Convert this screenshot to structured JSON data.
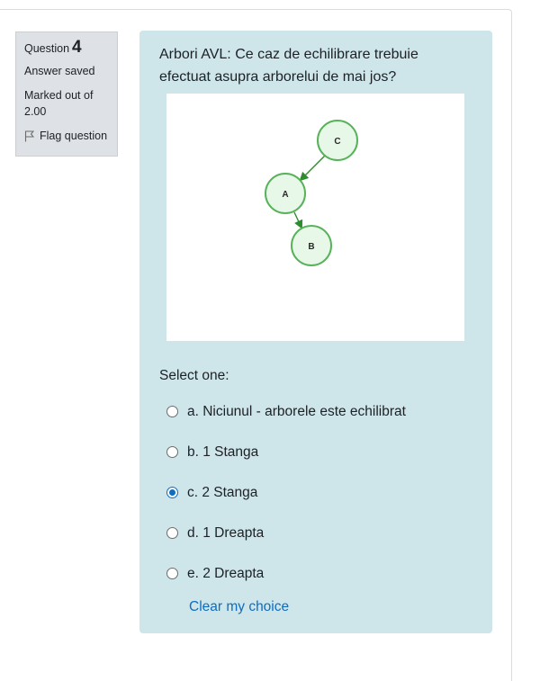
{
  "info": {
    "question_label": "Question",
    "question_number": "4",
    "state": "Answer saved",
    "grade": "Marked out of 2.00",
    "flag_label": "Flag question"
  },
  "question": {
    "text": "Arbori AVL: Ce caz de echilibrare trebuie efectuat asupra arborelui de mai jos?",
    "prompt": "Select one:",
    "options": [
      {
        "label": "a. Niciunul - arborele este echilibrat",
        "selected": false
      },
      {
        "label": "b. 1 Stanga",
        "selected": false
      },
      {
        "label": "c. 2 Stanga",
        "selected": true
      },
      {
        "label": "d. 1 Dreapta",
        "selected": false
      },
      {
        "label": "e. 2 Dreapta",
        "selected": false
      }
    ],
    "clear_label": "Clear my choice"
  },
  "tree": {
    "nodes": [
      {
        "id": "C",
        "label": "C"
      },
      {
        "id": "A",
        "label": "A"
      },
      {
        "id": "B",
        "label": "B"
      }
    ],
    "edges": [
      {
        "from": "C",
        "to": "A"
      },
      {
        "from": "A",
        "to": "B"
      }
    ],
    "node_fill": "#e8f8e8",
    "node_stroke": "#58b25a",
    "edge_color": "#2e8b2e"
  },
  "colors": {
    "content_bg": "#cee6ea",
    "info_bg": "#dee2e6",
    "link": "#0f6cbf"
  }
}
